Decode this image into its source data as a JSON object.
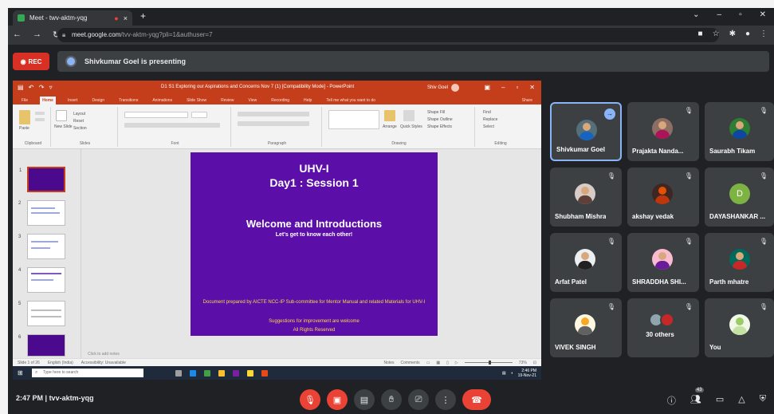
{
  "browser": {
    "tab_title": "Meet - twv-aktm-yqg",
    "tab_rec_icon": "●",
    "tab_close_icon": "×",
    "new_tab_icon": "+",
    "url_host": "meet.google.com",
    "url_path": "/tvv-aktm-yqg?pli=1&authuser=7"
  },
  "meet": {
    "rec_label": "REC",
    "presenting_text": "Shivkumar Goel is presenting",
    "meeting_code": "tvv-aktm-yqg",
    "time": "2:47 PM",
    "participant_count": "43"
  },
  "ppt": {
    "doc_title": "D1 S1 Exploring our Aspirations and Concerns Nov 7 (1) [Compatibility Mode] - PowerPoint",
    "user_name": "Shiv Goel",
    "menu": [
      "File",
      "Home",
      "Insert",
      "Design",
      "Transitions",
      "Animations",
      "Slide Show",
      "Review",
      "View",
      "Recording",
      "Help",
      "Tell me what you want to do"
    ],
    "share": "Share",
    "ribbon": {
      "clipboard": "Clipboard",
      "paste": "Paste",
      "new_slide": "New Slide",
      "layout": "Layout",
      "reset": "Reset",
      "section": "Section",
      "slides": "Slides",
      "font": "Font",
      "paragraph": "Paragraph",
      "drawing": "Drawing",
      "arrange": "Arrange",
      "quick_styles": "Quick Styles",
      "shape_fill": "Shape Fill",
      "shape_outline": "Shape Outline",
      "shape_effects": "Shape Effects",
      "find": "Find",
      "replace": "Replace",
      "select": "Select",
      "editing": "Editing"
    },
    "slide": {
      "title1": "UHV-I",
      "title2": "Day1 : Session 1",
      "welcome": "Welcome and Introductions",
      "subtitle": "Let's get to know each other!",
      "doc_note": "Document prepared by AICTE NCC-IP Sub-committee for Mentor Manual and related Materials for UHV-I",
      "suggestions": "Suggestions for improvement are welcome",
      "rights": "All Rights Reserved"
    },
    "thumb_numbers": [
      "1",
      "2",
      "3",
      "4",
      "5",
      "6"
    ],
    "notes_placeholder": "Click to add notes",
    "status": {
      "slide_of": "Slide 1 of 26",
      "language": "English (India)",
      "accessibility": "Accessibility: Unavailable",
      "notes": "Notes",
      "comments": "Comments",
      "zoom": "73%"
    },
    "taskbar": {
      "search_placeholder": "Type here to search",
      "clock_time": "2:46 PM",
      "clock_date": "19-Nov-21"
    }
  },
  "participants": [
    {
      "name": "Shivkumar Goel",
      "active": true
    },
    {
      "name": "Prajakta Nanda..."
    },
    {
      "name": "Saurabh Tikam"
    },
    {
      "name": "Shubham Mishra"
    },
    {
      "name": "akshay vedak"
    },
    {
      "name": "DAYASHANKAR ...",
      "initial": "D"
    },
    {
      "name": "Arfat Patel"
    },
    {
      "name": "SHRADDHA SHI..."
    },
    {
      "name": "Parth mhatre"
    },
    {
      "name": "VIVEK SINGH"
    },
    {
      "name": "30 others"
    },
    {
      "name": "You"
    }
  ],
  "colors": {
    "meet_bg": "#202124",
    "tile_bg": "#3c4043",
    "rec_red": "#d93025",
    "ppt_orange": "#c43e1c",
    "slide_purple": "#5b0fa8",
    "slide_yellow": "#ffd54f"
  }
}
